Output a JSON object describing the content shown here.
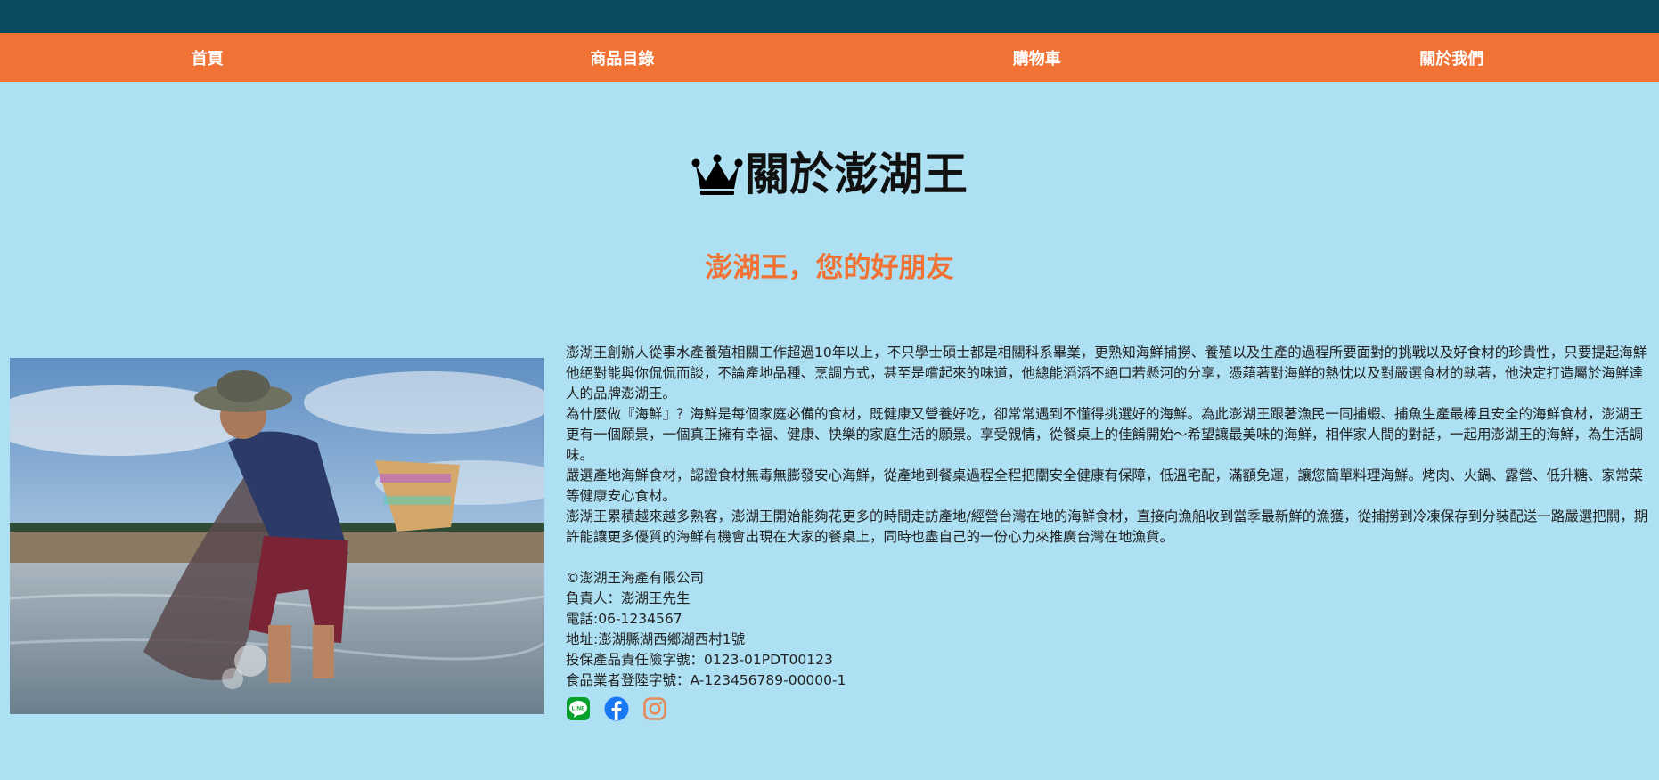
{
  "nav": {
    "items": [
      {
        "label": "首頁"
      },
      {
        "label": "商品目錄"
      },
      {
        "label": "購物車"
      },
      {
        "label": "關於我們"
      }
    ]
  },
  "header": {
    "title": "關於澎湖王",
    "subtitle": "澎湖王，您的好朋友"
  },
  "about": {
    "paragraphs": [
      "澎湖王創辦人從事水產養殖相關工作超過10年以上，不只學士碩士都是相關科系畢業，更熟知海鮮捕撈、養殖以及生產的過程所要面對的挑戰以及好食材的珍貴性，只要提起海鮮他絕對能與你侃侃而談，不論產地品種、烹調方式，甚至是嚐起來的味道，他總能滔滔不絕口若懸河的分享，憑藉著對海鮮的熱忱以及對嚴選食材的執著，他決定打造屬於海鮮達人的品牌澎湖王。",
      "為什麼做『海鮮』？海鮮是每個家庭必備的食材，既健康又營養好吃，卻常常遇到不懂得挑選好的海鮮。為此澎湖王跟著漁民一同捕蝦、捕魚生產最棒且安全的海鮮食材，澎湖王更有一個願景，一個真正擁有幸福、健康、快樂的家庭生活的願景。享受親情，從餐桌上的佳餚開始～希望讓最美味的海鮮，相伴家人間的對話，一起用澎湖王的海鮮，為生活調味。",
      "嚴選產地海鮮食材，認證食材無毒無膨發安心海鮮，從產地到餐桌過程全程把關安全健康有保障，低溫宅配，滿額免運，讓您簡單料理海鮮。烤肉、火鍋、露營、低升糖、家常菜等健康安心食材。",
      "澎湖王累積越來越多熟客，澎湖王開始能夠花更多的時間走訪產地/經營台灣在地的海鮮食材，直接向漁船收到當季最新鮮的漁獲，從捕撈到冷凍保存到分裝配送一路嚴選把關，期許能讓更多優質的海鮮有機會出現在大家的餐桌上，同時也盡自己的一份心力來推廣台灣在地漁貨。"
    ]
  },
  "company": {
    "name": "©澎湖王海產有限公司",
    "owner": "負責人：澎湖王先生",
    "phone": "電話:06-1234567",
    "address": "地址:澎湖縣湖西鄉湖西村1號",
    "insurance": "投保產品責任險字號：0123-01PDT00123",
    "registration": "食品業者登陸字號：A-123456789-00000-1"
  },
  "social": {
    "icons": [
      "line-icon",
      "facebook-icon",
      "instagram-icon"
    ]
  },
  "colors": {
    "topbar": "#0c4a61",
    "navbar": "#f07234",
    "background": "#ade0f2",
    "accent": "#f07234",
    "line": "#06a12a",
    "facebook": "#1877f2",
    "instagram": "#e68a5c"
  }
}
